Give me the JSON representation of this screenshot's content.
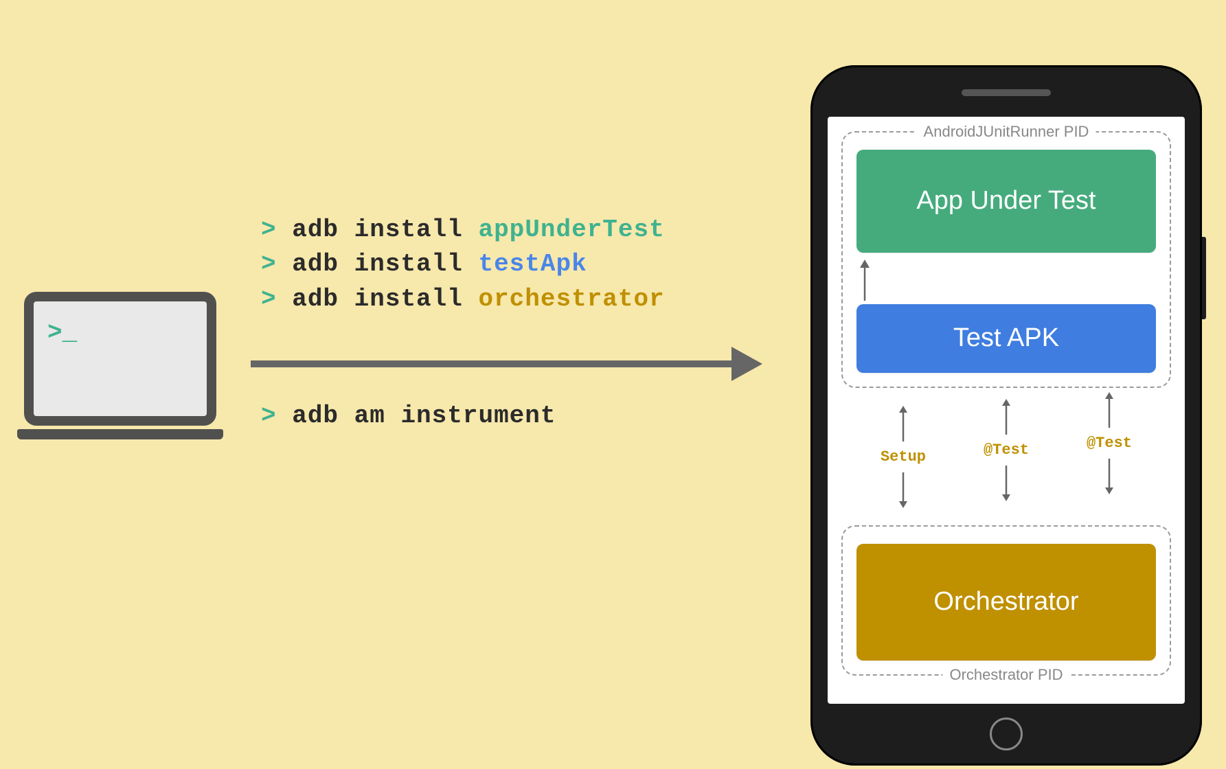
{
  "laptop": {
    "prompt": ">_"
  },
  "commands": [
    {
      "prompt": ">",
      "cmd": "adb install",
      "arg": "appUnderTest",
      "argClass": "arg-green"
    },
    {
      "prompt": ">",
      "cmd": "adb install",
      "arg": "testApk",
      "argClass": "arg-blue"
    },
    {
      "prompt": ">",
      "cmd": "adb install",
      "arg": "orchestrator",
      "argClass": "arg-gold"
    }
  ],
  "command_after_arrow": {
    "prompt": ">",
    "cmd": "adb am instrument"
  },
  "phone": {
    "runner_group_label": "AndroidJUnitRunner PID",
    "app_under_test": "App Under Test",
    "test_apk": "Test APK",
    "orchestrator_group_label": "Orchestrator PID",
    "orchestrator": "Orchestrator",
    "arrow_labels": [
      "Setup",
      "@Test",
      "@Test"
    ]
  }
}
